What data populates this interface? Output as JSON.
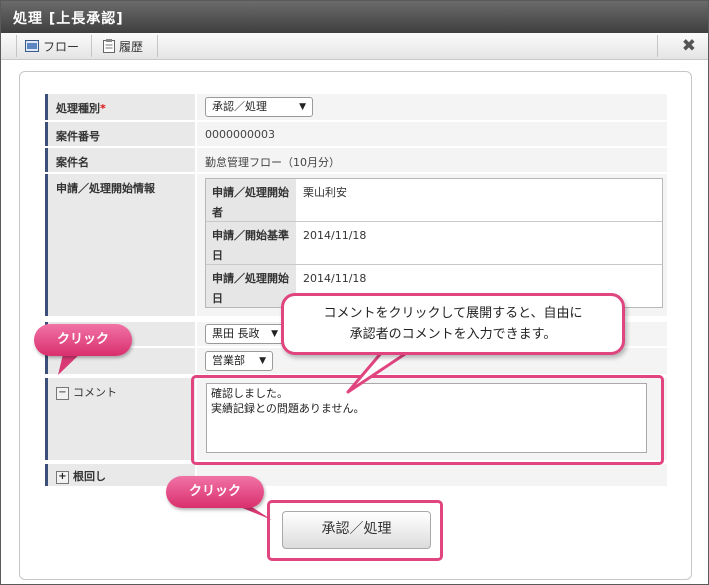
{
  "window": {
    "title": "処理  [上長承認]"
  },
  "toolbar": {
    "flow_label": "フロー",
    "history_label": "履歴",
    "close_glyph": "✖"
  },
  "form": {
    "type": {
      "label": "処理種別",
      "required_mark": "*",
      "value": "承認／処理"
    },
    "case_number": {
      "label": "案件番号",
      "value": "0000000003"
    },
    "case_name": {
      "label": "案件名",
      "value": "勤怠管理フロー（10月分）"
    },
    "start_info": {
      "label": "申請／処理開始情報",
      "rows": [
        {
          "label": "申請／処理開始者",
          "value": "栗山利安"
        },
        {
          "label": "申請／開始基準日",
          "value": "2014/11/18"
        },
        {
          "label": "申請／処理開始日",
          "value": "2014/11/18"
        }
      ]
    },
    "user_select": {
      "value": "黒田 長政"
    },
    "dept_select": {
      "value": "営業部"
    },
    "comment": {
      "label": "コメント",
      "toggle": "−",
      "value": "確認しました。\n実績記録との問題ありません。"
    },
    "nemawashi": {
      "label": "根回し",
      "toggle": "+"
    }
  },
  "submit": {
    "label": "承認／処理"
  },
  "callouts": {
    "bubble_line1": "コメントをクリックして展開すると、自由に",
    "bubble_line2": "承認者のコメントを入力できます。",
    "click_label": "クリック"
  },
  "colors": {
    "accent": "#e0457f",
    "label_border": "#3b4f7a"
  }
}
